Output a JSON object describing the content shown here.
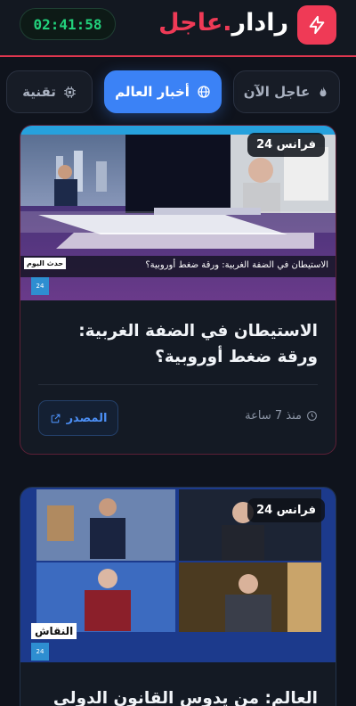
{
  "header": {
    "brand_part1": "رادار",
    "brand_part2": ".عاجل",
    "clock": "02:41:58",
    "logo_icon": "lightning-icon",
    "accent_color": "#ef3a56",
    "clock_color": "#22d17c"
  },
  "tabs": [
    {
      "label": "عاجل الآن",
      "icon": "flame-icon",
      "active": false
    },
    {
      "label": "أخبار العالم",
      "icon": "globe-icon",
      "active": true
    },
    {
      "label": "تقنية",
      "icon": "chip-icon",
      "active": false
    }
  ],
  "cards": [
    {
      "source": "فرانس 24",
      "image_caption": "الاستيطان في الضفة الغربية: ورقة ضغط أوروبية؟",
      "show_label": "حدث اليوم",
      "headline": "الاستيطان في الضفة الغربية: ورقة ضغط أوروبية؟",
      "time": "منذ 7 ساعة",
      "source_button": "المصدر"
    },
    {
      "source": "فرانس 24",
      "show_label": "النقاش",
      "headline": "العالم: من يدوس القانون الدولي ولماذا"
    }
  ]
}
